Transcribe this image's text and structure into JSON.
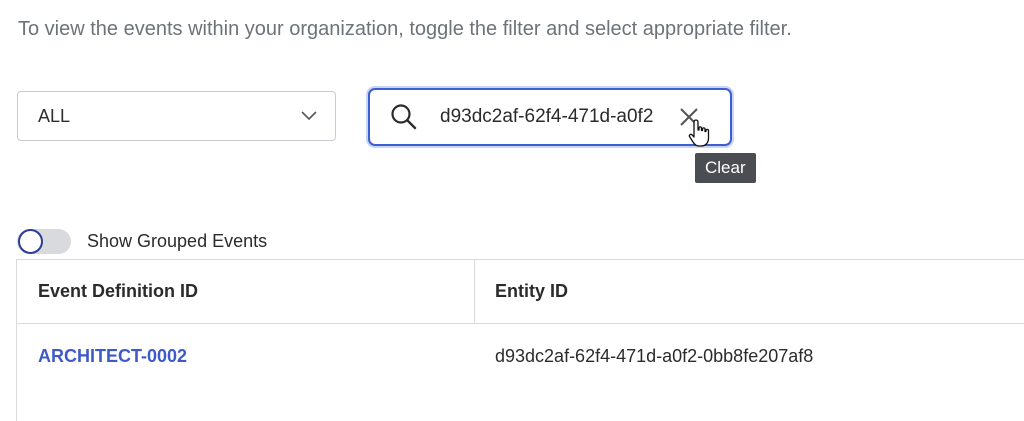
{
  "intro_text": "To view the events within your organization, toggle the filter and select appropriate filter.",
  "filter": {
    "selected": "ALL",
    "icon": "chevron-down-icon"
  },
  "search": {
    "value": "d93dc2af-62f4-471d-a0f2",
    "icon": "search-icon",
    "clear_icon": "close-icon"
  },
  "tooltip": {
    "text": "Clear"
  },
  "toggle": {
    "label": "Show Grouped Events",
    "on": false
  },
  "table": {
    "columns": [
      "Event Definition ID",
      "Entity ID"
    ],
    "rows": [
      {
        "event_definition_id": "ARCHITECT-0002",
        "entity_id": "d93dc2af-62f4-471d-a0f2-0bb8fe207af8"
      }
    ]
  },
  "colors": {
    "accent": "#3d5fd1",
    "link": "#3e59c9",
    "tooltip_bg": "#4a4d52"
  }
}
